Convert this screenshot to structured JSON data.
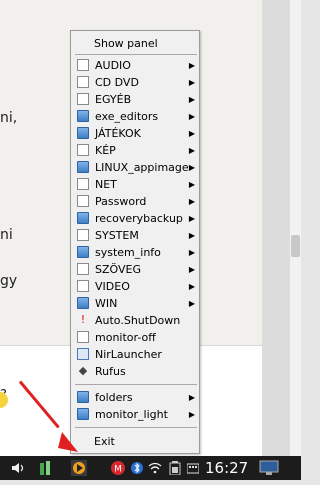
{
  "background": {
    "fragments": [
      "ni,",
      "ni",
      "gy",
      "?"
    ]
  },
  "menu": {
    "items": [
      {
        "label": "Show panel",
        "icon": "none",
        "submenu": false
      },
      {
        "label": "AUDIO",
        "icon": "checkbox-icon",
        "submenu": true
      },
      {
        "label": "CD DVD",
        "icon": "checkbox-icon",
        "submenu": true
      },
      {
        "label": "EGYÉB",
        "icon": "checkbox-icon",
        "submenu": true
      },
      {
        "label": "exe_editors",
        "icon": "folder-icon",
        "submenu": true
      },
      {
        "label": "JÁTÉKOK",
        "icon": "folder-icon",
        "submenu": true
      },
      {
        "label": "KÉP",
        "icon": "checkbox-icon",
        "submenu": true
      },
      {
        "label": "LINUX_appimage",
        "icon": "folder-icon",
        "submenu": true
      },
      {
        "label": "NET",
        "icon": "checkbox-icon",
        "submenu": true
      },
      {
        "label": "Password",
        "icon": "checkbox-icon",
        "submenu": true
      },
      {
        "label": "recoverybackup",
        "icon": "folder-icon",
        "submenu": true
      },
      {
        "label": "SYSTEM",
        "icon": "checkbox-icon",
        "submenu": true
      },
      {
        "label": "system_info",
        "icon": "folder-icon",
        "submenu": true
      },
      {
        "label": "SZÖVEG",
        "icon": "checkbox-icon",
        "submenu": true
      },
      {
        "label": "VIDEO",
        "icon": "checkbox-icon",
        "submenu": true
      },
      {
        "label": "WIN",
        "icon": "folder-icon",
        "submenu": true
      },
      {
        "label": "Auto.ShutDown",
        "icon": "shutdown-app-icon",
        "submenu": false
      },
      {
        "label": "monitor-off",
        "icon": "checkbox-icon",
        "submenu": false
      },
      {
        "label": "NirLauncher",
        "icon": "nirlauncher-icon",
        "submenu": false
      },
      {
        "label": "Rufus",
        "icon": "rufus-icon",
        "submenu": false
      },
      {
        "label": "folders",
        "icon": "folder-icon",
        "submenu": true
      },
      {
        "label": "monitor_light",
        "icon": "folder-icon",
        "submenu": true
      },
      {
        "label": "Exit",
        "icon": "none",
        "submenu": false
      }
    ],
    "arrow_glyph": "▶"
  },
  "taskbar": {
    "clock": "16:27",
    "icons": [
      "speaker-icon",
      "audio-app-icon",
      "play-launcher-icon",
      "mega-icon",
      "bluetooth-icon",
      "wifi-icon",
      "battery-icon",
      "keyboard-icon",
      "desktop-icon"
    ]
  },
  "colors": {
    "annotation_arrow": "#e02020",
    "taskbar_bg": "#1c1c1c",
    "menu_bg": "#f0f0f0"
  }
}
